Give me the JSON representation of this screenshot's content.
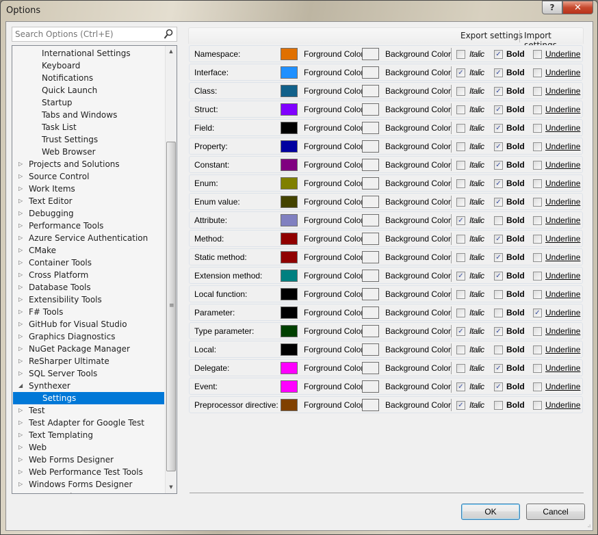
{
  "window": {
    "title": "Options",
    "help_label": "?",
    "close_label": "✕"
  },
  "search": {
    "placeholder": "Search Options (Ctrl+E)",
    "icon": "search-icon"
  },
  "tree": {
    "items": [
      {
        "label": "International Settings",
        "level": 1,
        "expander": "none"
      },
      {
        "label": "Keyboard",
        "level": 1,
        "expander": "none"
      },
      {
        "label": "Notifications",
        "level": 1,
        "expander": "none"
      },
      {
        "label": "Quick Launch",
        "level": 1,
        "expander": "none"
      },
      {
        "label": "Startup",
        "level": 1,
        "expander": "none"
      },
      {
        "label": "Tabs and Windows",
        "level": 1,
        "expander": "none"
      },
      {
        "label": "Task List",
        "level": 1,
        "expander": "none"
      },
      {
        "label": "Trust Settings",
        "level": 1,
        "expander": "none"
      },
      {
        "label": "Web Browser",
        "level": 1,
        "expander": "none"
      },
      {
        "label": "Projects and Solutions",
        "level": 0,
        "expander": "collapsed"
      },
      {
        "label": "Source Control",
        "level": 0,
        "expander": "collapsed"
      },
      {
        "label": "Work Items",
        "level": 0,
        "expander": "collapsed"
      },
      {
        "label": "Text Editor",
        "level": 0,
        "expander": "collapsed"
      },
      {
        "label": "Debugging",
        "level": 0,
        "expander": "collapsed"
      },
      {
        "label": "Performance Tools",
        "level": 0,
        "expander": "collapsed"
      },
      {
        "label": "Azure Service Authentication",
        "level": 0,
        "expander": "collapsed"
      },
      {
        "label": "CMake",
        "level": 0,
        "expander": "collapsed"
      },
      {
        "label": "Container Tools",
        "level": 0,
        "expander": "collapsed"
      },
      {
        "label": "Cross Platform",
        "level": 0,
        "expander": "collapsed"
      },
      {
        "label": "Database Tools",
        "level": 0,
        "expander": "collapsed"
      },
      {
        "label": "Extensibility Tools",
        "level": 0,
        "expander": "collapsed"
      },
      {
        "label": "F# Tools",
        "level": 0,
        "expander": "collapsed"
      },
      {
        "label": "GitHub for Visual Studio",
        "level": 0,
        "expander": "collapsed"
      },
      {
        "label": "Graphics Diagnostics",
        "level": 0,
        "expander": "collapsed"
      },
      {
        "label": "NuGet Package Manager",
        "level": 0,
        "expander": "collapsed"
      },
      {
        "label": "ReSharper Ultimate",
        "level": 0,
        "expander": "collapsed"
      },
      {
        "label": "SQL Server Tools",
        "level": 0,
        "expander": "collapsed"
      },
      {
        "label": "Synthexer",
        "level": 0,
        "expander": "expanded"
      },
      {
        "label": "Settings",
        "level": 1,
        "expander": "none",
        "selected": true
      },
      {
        "label": "Test",
        "level": 0,
        "expander": "collapsed"
      },
      {
        "label": "Test Adapter for Google Test",
        "level": 0,
        "expander": "collapsed"
      },
      {
        "label": "Text Templating",
        "level": 0,
        "expander": "collapsed"
      },
      {
        "label": "Web",
        "level": 0,
        "expander": "collapsed"
      },
      {
        "label": "Web Forms Designer",
        "level": 0,
        "expander": "collapsed"
      },
      {
        "label": "Web Performance Test Tools",
        "level": 0,
        "expander": "collapsed"
      },
      {
        "label": "Windows Forms Designer",
        "level": 0,
        "expander": "collapsed"
      },
      {
        "label": "XAML Designer",
        "level": 0,
        "expander": "collapsed",
        "partial": true
      }
    ]
  },
  "header": {
    "export_label": "Export settings",
    "import_label": "Import settings"
  },
  "labels": {
    "foreground": "Forground Color",
    "background": "Background Color",
    "italic": "Italic",
    "bold": "Bold",
    "underline": "Underline"
  },
  "styles": [
    {
      "name": "Namespace:",
      "fg": "#e07000",
      "bg": "#f0f0f0",
      "italic": false,
      "bold": true,
      "underline": false
    },
    {
      "name": "Interface:",
      "fg": "#1e90ff",
      "bg": "#f0f0f0",
      "italic": true,
      "bold": true,
      "underline": false
    },
    {
      "name": "Class:",
      "fg": "#12618a",
      "bg": "#f0f0f0",
      "italic": false,
      "bold": true,
      "underline": false
    },
    {
      "name": "Struct:",
      "fg": "#8000ff",
      "bg": "#f0f0f0",
      "italic": false,
      "bold": true,
      "underline": false
    },
    {
      "name": "Field:",
      "fg": "#000000",
      "bg": "#f0f0f0",
      "italic": false,
      "bold": true,
      "underline": false
    },
    {
      "name": "Property:",
      "fg": "#0000a0",
      "bg": "#f0f0f0",
      "italic": false,
      "bold": true,
      "underline": false
    },
    {
      "name": "Constant:",
      "fg": "#800080",
      "bg": "#f0f0f0",
      "italic": false,
      "bold": true,
      "underline": false
    },
    {
      "name": "Enum:",
      "fg": "#808000",
      "bg": "#f0f0f0",
      "italic": false,
      "bold": true,
      "underline": false
    },
    {
      "name": "Enum value:",
      "fg": "#434300",
      "bg": "#f0f0f0",
      "italic": false,
      "bold": true,
      "underline": false
    },
    {
      "name": "Attribute:",
      "fg": "#8080c0",
      "bg": "#f0f0f0",
      "italic": true,
      "bold": false,
      "underline": false
    },
    {
      "name": "Method:",
      "fg": "#900000",
      "bg": "#f0f0f0",
      "italic": false,
      "bold": true,
      "underline": false
    },
    {
      "name": "Static method:",
      "fg": "#900000",
      "bg": "#f0f0f0",
      "italic": false,
      "bold": true,
      "underline": false
    },
    {
      "name": "Extension method:",
      "fg": "#008080",
      "bg": "#f0f0f0",
      "italic": true,
      "bold": true,
      "underline": false
    },
    {
      "name": "Local function:",
      "fg": "#000000",
      "bg": "#f0f0f0",
      "italic": false,
      "bold": false,
      "underline": false
    },
    {
      "name": "Parameter:",
      "fg": "#000000",
      "bg": "#f0f0f0",
      "italic": false,
      "bold": false,
      "underline": true
    },
    {
      "name": "Type parameter:",
      "fg": "#004000",
      "bg": "#f0f0f0",
      "italic": true,
      "bold": true,
      "underline": false
    },
    {
      "name": "Local:",
      "fg": "#000000",
      "bg": "#f0f0f0",
      "italic": false,
      "bold": false,
      "underline": false
    },
    {
      "name": "Delegate:",
      "fg": "#ff00ff",
      "bg": "#f0f0f0",
      "italic": false,
      "bold": true,
      "underline": false
    },
    {
      "name": "Event:",
      "fg": "#ff00ff",
      "bg": "#f0f0f0",
      "italic": true,
      "bold": true,
      "underline": false
    },
    {
      "name": "Preprocessor directive:",
      "fg": "#804000",
      "bg": "#f0f0f0",
      "italic": true,
      "bold": false,
      "underline": false
    }
  ],
  "buttons": {
    "ok_label": "OK",
    "cancel_label": "Cancel"
  },
  "colors": {
    "selection": "#0078d7",
    "check": "#3a4fa0"
  }
}
